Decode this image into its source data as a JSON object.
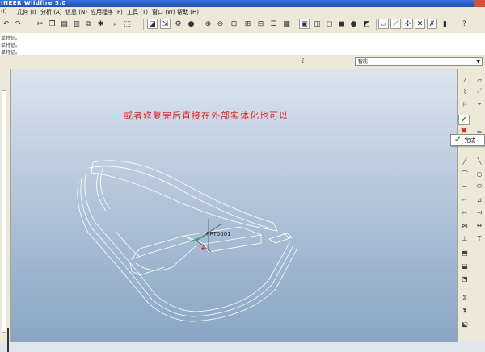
{
  "window": {
    "title": "INEER Wildfire 5.0"
  },
  "menu": [
    {
      "label": "(I)"
    },
    {
      "label": "几何 (I)"
    },
    {
      "label": "分析 (A)"
    },
    {
      "label": "信息 (N)"
    },
    {
      "label": "应用程序 (P)"
    },
    {
      "label": "工具 (T)"
    },
    {
      "label": "窗口 (W)"
    },
    {
      "label": "帮助 (H)"
    }
  ],
  "messages": [
    "单特征。",
    "单特征。",
    "单特征。"
  ],
  "filter": {
    "selected": "智能"
  },
  "graphics": {
    "annotation": "或者修复完后直接在外部实体化也可以",
    "csys_label": "PRT0001"
  },
  "dashboard": {
    "done_label": "完成"
  },
  "colors": {
    "title_bar": "#1c50b7",
    "annotation": "#e02020",
    "confirm_green": "#1e9a1e",
    "cancel_red": "#dd2222"
  }
}
